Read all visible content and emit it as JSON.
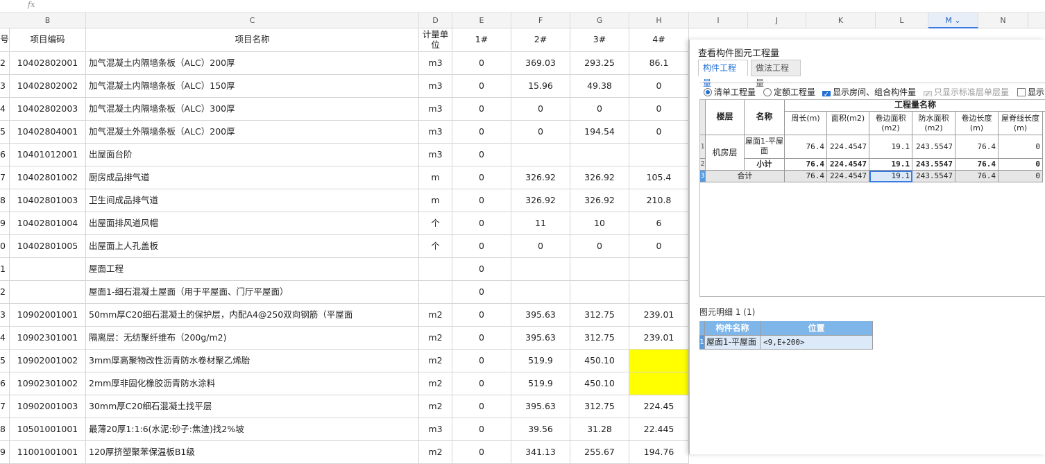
{
  "formula_bar": {
    "fx": "fx"
  },
  "columns": [
    "B",
    "C",
    "D",
    "E",
    "F",
    "G",
    "H",
    "I",
    "J",
    "K",
    "L",
    "M",
    "N"
  ],
  "header": {
    "seq": "号",
    "code": "项目编码",
    "name": "项目名称",
    "unit": "计量单位",
    "e": "1#",
    "f": "2#",
    "g": "3#",
    "h": "4#"
  },
  "rows": [
    {
      "n": "2",
      "code": "10402802001",
      "name": "加气混凝土内隔墙条板（ALC）200厚",
      "unit": "m3",
      "e": "0",
      "f": "369.03",
      "g": "293.25",
      "h": "86.1"
    },
    {
      "n": "3",
      "code": "10402802002",
      "name": "加气混凝土内隔墙条板（ALC）150厚",
      "unit": "m3",
      "e": "0",
      "f": "15.96",
      "g": "49.38",
      "h": "0"
    },
    {
      "n": "4",
      "code": "10402802003",
      "name": "加气混凝土内隔墙条板（ALC）300厚",
      "unit": "m3",
      "e": "0",
      "f": "0",
      "g": "0",
      "h": "0"
    },
    {
      "n": "5",
      "code": "10402804001",
      "name": "加气混凝土外隔墙条板（ALC）200厚",
      "unit": "m3",
      "e": "0",
      "f": "0",
      "g": "194.54",
      "h": "0"
    },
    {
      "n": "6",
      "code": "10401012001",
      "name": "出屋面台阶",
      "unit": "m3",
      "e": "0",
      "f": "",
      "g": "",
      "h": ""
    },
    {
      "n": "7",
      "code": "10402801002",
      "name": "厨房成品排气道",
      "unit": "m",
      "e": "0",
      "f": "326.92",
      "g": "326.92",
      "h": "105.4"
    },
    {
      "n": "8",
      "code": "10402801003",
      "name": "卫生间成品排气道",
      "unit": "m",
      "e": "0",
      "f": "326.92",
      "g": "326.92",
      "h": "210.8"
    },
    {
      "n": "9",
      "code": "10402801004",
      "name": "出屋面排风道风帽",
      "unit": "个",
      "e": "0",
      "f": "11",
      "g": "10",
      "h": "6"
    },
    {
      "n": "0",
      "code": "10402801005",
      "name": "出屋面上人孔盖板",
      "unit": "个",
      "e": "0",
      "f": "0",
      "g": "0",
      "h": "0"
    },
    {
      "n": "1",
      "code": "",
      "name": "屋面工程",
      "unit": "",
      "e": "0",
      "f": "",
      "g": "",
      "h": ""
    },
    {
      "n": "2",
      "code": "",
      "name": "屋面1-细石混凝土屋面（用于平屋面、门厅平屋面）",
      "unit": "",
      "e": "0",
      "f": "",
      "g": "",
      "h": ""
    },
    {
      "n": "3",
      "code": "10902001001",
      "name": "50mm厚C20细石混凝土的保护层，内配A4@250双向钢筋（平屋面",
      "unit": "m2",
      "e": "0",
      "f": "395.63",
      "g": "312.75",
      "h": "239.01"
    },
    {
      "n": "4",
      "code": "10902301001",
      "name": "隔离层：无纺聚纤维布（200g/m2)",
      "unit": "m2",
      "e": "0",
      "f": "395.63",
      "g": "312.75",
      "h": "239.01"
    },
    {
      "n": "5",
      "code": "10902001002",
      "name": "3mm厚高聚物改性沥青防水卷材聚乙烯胎",
      "unit": "m2",
      "e": "0",
      "f": "519.9",
      "g": "450.10",
      "h": ""
    },
    {
      "n": "6",
      "code": "10902301002",
      "name": "2mm厚非固化橡胶沥青防水涂料",
      "unit": "m2",
      "e": "0",
      "f": "519.9",
      "g": "450.10",
      "h": ""
    },
    {
      "n": "7",
      "code": "10902001003",
      "name": "30mm厚C20细石混凝土找平层",
      "unit": "m2",
      "e": "0",
      "f": "395.63",
      "g": "312.75",
      "h": "224.45"
    },
    {
      "n": "8",
      "code": "10501001001",
      "name": "最薄20厚1:1:6(水泥:砂子:焦渣)找2%坡",
      "unit": "m3",
      "e": "0",
      "f": "39.56",
      "g": "31.28",
      "h": "22.445"
    },
    {
      "n": "9",
      "code": "11001001001",
      "name": "120厚挤塑聚苯保温板B1级",
      "unit": "m2",
      "e": "0",
      "f": "341.13",
      "g": "255.67",
      "h": "194.76"
    }
  ],
  "highlight_color": "#ffff00",
  "panel": {
    "title": "查看构件图元工程量",
    "tabs": [
      "构件工程量",
      "做法工程量"
    ],
    "options": {
      "qd": "清单工程量",
      "de": "定额工程量",
      "show_room": "显示房间、组合构件量",
      "std_only": "只显示标准层单层量",
      "show_more": "显示"
    },
    "table": {
      "col_floor": "楼层",
      "col_name": "名称",
      "group": "工程量名称",
      "metrics": [
        "周长(m)",
        "面积(m2)",
        "卷边面积(m2)",
        "防水面积(m2)",
        "卷边长度(m)",
        "屋脊线长度(m)"
      ],
      "rows": [
        {
          "rn": "1",
          "floor": "机房层",
          "name": "屋面1-平屋面",
          "vals": [
            "76.4",
            "224.4547",
            "19.1",
            "243.5547",
            "76.4",
            "0"
          ]
        },
        {
          "rn": "2",
          "floor": "",
          "name": "小计",
          "vals": [
            "76.4",
            "224.4547",
            "19.1",
            "243.5547",
            "76.4",
            "0"
          ]
        },
        {
          "rn": "3",
          "floor": "合计",
          "name": "",
          "vals": [
            "76.4",
            "224.4547",
            "19.1",
            "243.5547",
            "76.4",
            "0"
          ]
        }
      ]
    },
    "detail": {
      "label": "图元明细  1 (1)",
      "headers": [
        "构件名称",
        "位置"
      ],
      "rows": [
        {
          "rn": "1",
          "name": "屋面1-平屋面",
          "pos": "<9,E+200>"
        }
      ]
    }
  }
}
